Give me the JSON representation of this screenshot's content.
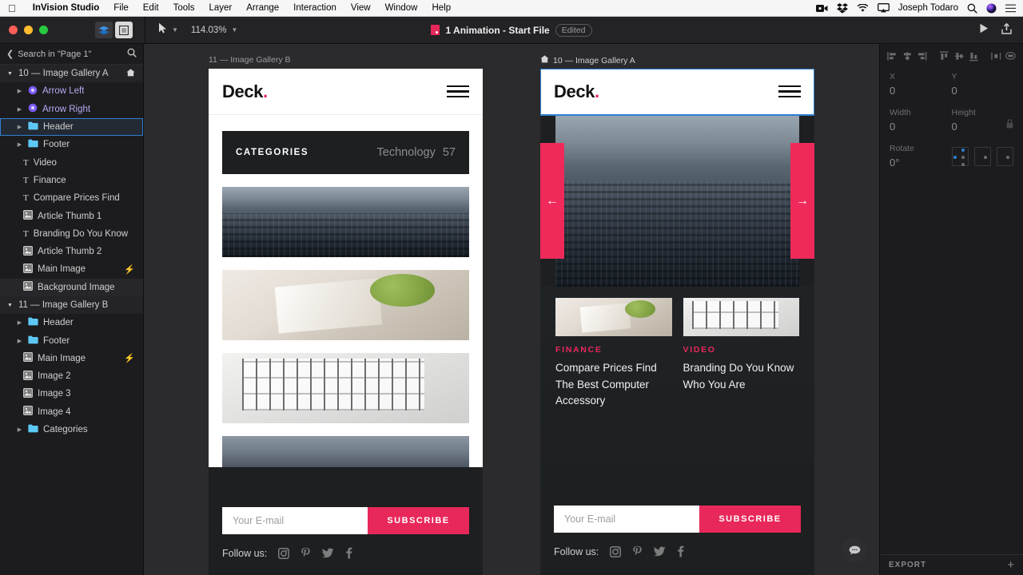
{
  "menubar": {
    "apple_icon": "apple-icon",
    "app_name": "InVision Studio",
    "items": [
      "File",
      "Edit",
      "Tools",
      "Layer",
      "Arrange",
      "Interaction",
      "View",
      "Window",
      "Help"
    ],
    "status_icons": [
      "screen-record-icon",
      "dropbox-icon",
      "wifi-icon",
      "airplay-icon"
    ],
    "user": "Joseph Todaro",
    "right_icons": [
      "spotlight-search-icon",
      "siri-icon",
      "control-center-icon"
    ]
  },
  "toolbar": {
    "window_controls": [
      "close-button",
      "minimize-button",
      "zoom-button"
    ],
    "toggle_layers": "layers-panel-toggle",
    "toggle_components": "components-panel-toggle",
    "cursor_tool": "select-tool",
    "zoom_level": "114.03%",
    "doc_title": "1 Animation - Start File",
    "doc_badge": "Edited",
    "preview_button": "preview-play-icon",
    "share_button": "share-upload-icon"
  },
  "sidebar": {
    "search_label": "Search in \"Page 1\"",
    "search_icon": "search-icon",
    "back_icon": "chevron-left-icon",
    "groups": [
      {
        "label": "10 — Image Gallery A",
        "type": "artboard",
        "home": true,
        "expanded": true,
        "items": [
          {
            "label": "Arrow Left",
            "type": "component",
            "disc": true,
            "bolt": false,
            "selected": false,
            "hovered": false
          },
          {
            "label": "Arrow Right",
            "type": "component",
            "disc": true,
            "bolt": false,
            "selected": false,
            "hovered": false
          },
          {
            "label": "Header",
            "type": "folder",
            "disc": true,
            "bolt": false,
            "selected": true,
            "hovered": false
          },
          {
            "label": "Footer",
            "type": "folder",
            "disc": true,
            "bolt": false,
            "selected": false,
            "hovered": false
          },
          {
            "label": "Video",
            "type": "text",
            "disc": false,
            "bolt": false,
            "selected": false,
            "hovered": false
          },
          {
            "label": "Finance",
            "type": "text",
            "disc": false,
            "bolt": false,
            "selected": false,
            "hovered": false
          },
          {
            "label": "Compare Prices Find",
            "type": "text",
            "disc": false,
            "bolt": false,
            "selected": false,
            "hovered": false
          },
          {
            "label": "Article Thumb 1",
            "type": "image",
            "disc": false,
            "bolt": false,
            "selected": false,
            "hovered": false
          },
          {
            "label": "Branding Do You Know",
            "type": "text",
            "disc": false,
            "bolt": false,
            "selected": false,
            "hovered": false
          },
          {
            "label": "Article Thumb 2",
            "type": "image",
            "disc": false,
            "bolt": false,
            "selected": false,
            "hovered": false
          },
          {
            "label": "Main Image",
            "type": "image",
            "disc": false,
            "bolt": true,
            "selected": false,
            "hovered": false
          },
          {
            "label": "Background Image",
            "type": "image",
            "disc": false,
            "bolt": false,
            "selected": false,
            "hovered": true
          }
        ]
      },
      {
        "label": "11 — Image Gallery B",
        "type": "artboard",
        "home": false,
        "expanded": true,
        "items": [
          {
            "label": "Header",
            "type": "folder",
            "disc": true,
            "bolt": false,
            "selected": false,
            "hovered": false
          },
          {
            "label": "Footer",
            "type": "folder",
            "disc": true,
            "bolt": false,
            "selected": false,
            "hovered": false
          },
          {
            "label": "Main Image",
            "type": "image",
            "disc": false,
            "bolt": true,
            "selected": false,
            "hovered": false
          },
          {
            "label": "Image 2",
            "type": "image",
            "disc": false,
            "bolt": false,
            "selected": false,
            "hovered": false
          },
          {
            "label": "Image 3",
            "type": "image",
            "disc": false,
            "bolt": false,
            "selected": false,
            "hovered": false
          },
          {
            "label": "Image 4",
            "type": "image",
            "disc": false,
            "bolt": false,
            "selected": false,
            "hovered": false
          },
          {
            "label": "Categories",
            "type": "folder",
            "disc": true,
            "bolt": false,
            "selected": false,
            "hovered": false
          }
        ]
      }
    ]
  },
  "canvas": {
    "artboard_b": {
      "label": "11 — Image Gallery B",
      "logo": "Deck",
      "logo_dot": ".",
      "menu_icon": "hamburger-menu-icon",
      "categories_label": "CATEGORIES",
      "categories_value": "Technology",
      "categories_count": "57",
      "thumbs": [
        "city-skyline-photo",
        "food-magazine-photo",
        "office-window-photo",
        "cloudscape-photo"
      ],
      "subscribe_placeholder": "Your E-mail",
      "subscribe_button": "SUBSCRIBE",
      "follow_label": "Follow us:",
      "social_icons": [
        "instagram-icon",
        "pinterest-icon",
        "twitter-icon",
        "facebook-icon"
      ]
    },
    "artboard_a": {
      "label": "10 — Image Gallery A",
      "home_icon": "home-artboard-icon",
      "logo": "Deck",
      "logo_dot": ".",
      "menu_icon": "hamburger-menu-icon",
      "arrow_left": "←",
      "arrow_right": "→",
      "hero_image": "city-skyline-photo",
      "cards": [
        {
          "tag": "FINANCE",
          "title": "Compare Prices Find The Best Computer Accessory",
          "image": "food-magazine-photo"
        },
        {
          "tag": "VIDEO",
          "title": "Branding Do You Know Who You Are",
          "image": "office-window-photo"
        }
      ],
      "subscribe_placeholder": "Your E-mail",
      "subscribe_button": "SUBSCRIBE",
      "follow_label": "Follow us:",
      "social_icons": [
        "instagram-icon",
        "pinterest-icon",
        "twitter-icon",
        "facebook-icon"
      ]
    }
  },
  "inspector": {
    "align_icons": [
      "align-left-icon",
      "align-center-h-icon",
      "align-right-icon",
      "align-top-icon",
      "align-middle-v-icon",
      "align-bottom-icon",
      "distribute-h-icon",
      "distribute-v-icon"
    ],
    "fields": [
      {
        "key": "X",
        "value": "0"
      },
      {
        "key": "Y",
        "value": "0"
      },
      {
        "key": "Width",
        "value": "0"
      },
      {
        "key": "Height",
        "value": "0"
      }
    ],
    "rotate_key": "Rotate",
    "rotate_value": "0°",
    "lock_icon": "lock-aspect-ratio-icon",
    "export_label": "EXPORT",
    "export_add": "+"
  },
  "overlay": {
    "chat_icon": "chat-help-icon",
    "cursor": "mouse-pointer"
  },
  "colors": {
    "accent_pink": "#e8285a",
    "selection_blue": "#2f7fd0",
    "panel_bg": "#1c1c1f",
    "canvas_bg": "#2b2b2e"
  }
}
